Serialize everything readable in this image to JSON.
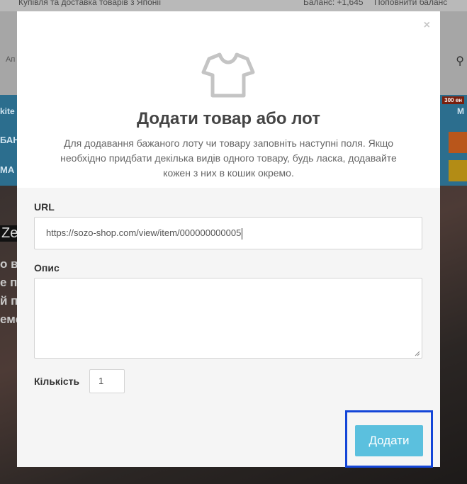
{
  "background": {
    "topbar_left": "Купівля та доставка товарів з Японії",
    "topbar_balance": "Баланс: +1,645",
    "topbar_topup": "Поповнити баланс",
    "nav_fragment": "Ап",
    "blue_1": "kite",
    "blue_2": "БАН",
    "blue_3": "МА",
    "badge": "300 ен",
    "mi": "М",
    "photo_ze": "Ze",
    "photo_lines": [
      "о во",
      "е по",
      "й п",
      "еме"
    ]
  },
  "modal": {
    "close_glyph": "×",
    "icon": "tshirt-icon",
    "title": "Додати товар або лот",
    "description": "Для додавання бажаного лоту чи товару заповніть наступні поля. Якщо необхідно придбати декілька видів одного товару, будь ласка, додавайте кожен з них в кошик окремо.",
    "url_label": "URL",
    "url_value": "https://sozo-shop.com/view/item/000000000005",
    "description_label": "Опис",
    "description_value": "",
    "quantity_label": "Кількість",
    "quantity_value": "1",
    "submit_label": "Додати"
  },
  "colors": {
    "accent": "#5bc0de",
    "highlight": "#1446d8"
  }
}
